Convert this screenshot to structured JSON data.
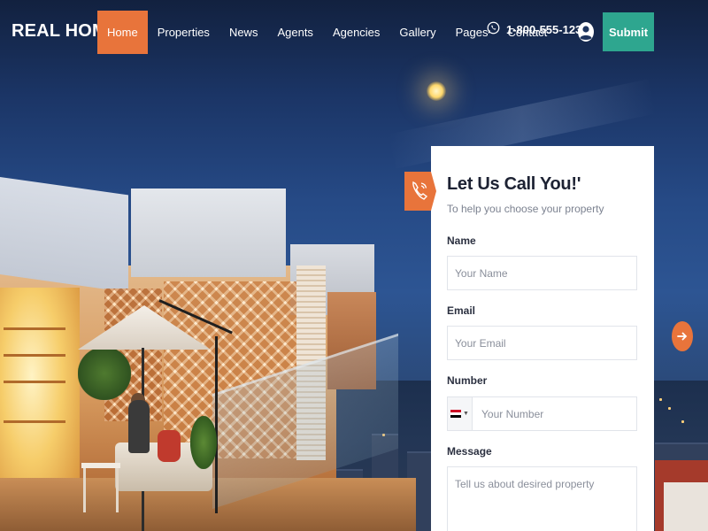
{
  "brand": {
    "logo_text": "REAL HOME"
  },
  "nav": {
    "items": [
      {
        "label": "Home",
        "active": true
      },
      {
        "label": "Properties"
      },
      {
        "label": "News"
      },
      {
        "label": "Agents"
      },
      {
        "label": "Agencies"
      },
      {
        "label": "Gallery"
      },
      {
        "label": "Pages"
      },
      {
        "label": "Contact"
      }
    ],
    "phone": "1-800-555-1234",
    "submit_label": "Submit"
  },
  "form": {
    "title": "Let Us Call You!'",
    "subtitle": "To help you choose your property",
    "name_label": "Name",
    "name_placeholder": "Your Name",
    "email_label": "Email",
    "email_placeholder": "Your Email",
    "number_label": "Number",
    "number_placeholder": "Your Number",
    "message_label": "Message",
    "message_placeholder": "Tell us about desired property"
  },
  "icons": {
    "phone": "whatsapp-icon",
    "user": "user-icon",
    "card_badge": "phone-call-icon",
    "slider": "arrow-right-icon"
  },
  "colors": {
    "accent": "#e8743b",
    "submit": "#2ea68f",
    "title": "#1d2233"
  }
}
